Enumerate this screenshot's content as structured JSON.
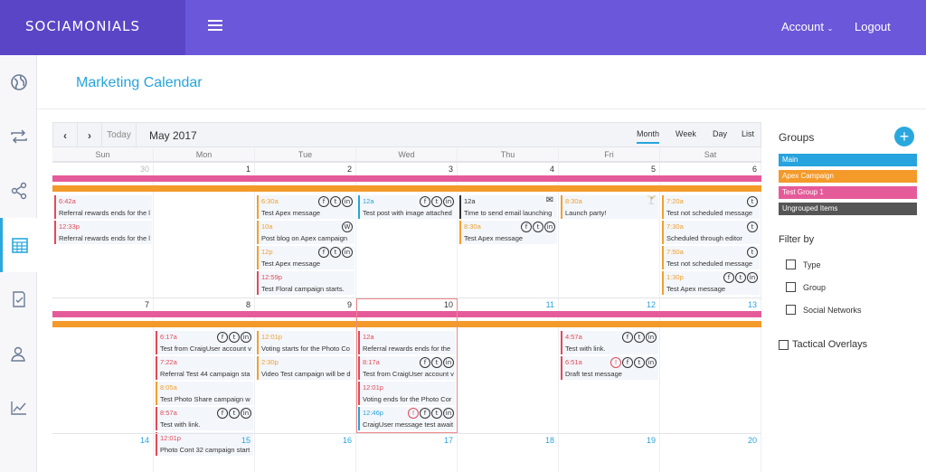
{
  "header": {
    "logo": "SOCIAMONIALS",
    "account_label": "Account",
    "logout_label": "Logout"
  },
  "sidebar": {
    "items": [
      {
        "icon": "globe-icon"
      },
      {
        "icon": "repeat-icon"
      },
      {
        "icon": "share-icon"
      },
      {
        "icon": "calendar-icon",
        "active": true
      },
      {
        "icon": "document-check-icon"
      },
      {
        "icon": "users-icon"
      },
      {
        "icon": "chart-icon"
      }
    ]
  },
  "page": {
    "title": "Marketing Calendar"
  },
  "calendar": {
    "today_label": "Today",
    "month_label": "May 2017",
    "views": [
      "Month",
      "Week",
      "Day",
      "List"
    ],
    "active_view": "Month",
    "dow": [
      "Sun",
      "Mon",
      "Tue",
      "Wed",
      "Thu",
      "Fri",
      "Sat"
    ],
    "weeks": [
      {
        "days": [
          "30",
          "1",
          "2",
          "3",
          "4",
          "5",
          "6"
        ],
        "events": [
          {
            "col": 0,
            "row": 0,
            "time": "6:42a",
            "text": "Referral rewards ends for the l",
            "color": "#e04b5a",
            "icons": []
          },
          {
            "col": 0,
            "row": 1,
            "time": "12:33p",
            "text": "Referral rewards ends for the l",
            "color": "#e04b5a",
            "icons": []
          },
          {
            "col": 2,
            "row": 0,
            "time": "6:30a",
            "text": "Test Apex message",
            "color": "#f0a030",
            "icons": [
              "f",
              "t",
              "in"
            ]
          },
          {
            "col": 2,
            "row": 1,
            "time": "10a",
            "text": "Post blog on Apex campaign",
            "color": "#f0a030",
            "icons": [
              "W"
            ]
          },
          {
            "col": 2,
            "row": 2,
            "time": "12p",
            "text": "Test Apex message",
            "color": "#f0a030",
            "icons": [
              "f",
              "t",
              "in"
            ]
          },
          {
            "col": 2,
            "row": 3,
            "time": "12:59p",
            "text": "Test Floral campaign starts.",
            "color": "#e04b5a",
            "icons": []
          },
          {
            "col": 3,
            "row": 0,
            "time": "12a",
            "text": "Test post with image attached",
            "color": "#27a4dd",
            "icons": [
              "f",
              "t",
              "in"
            ]
          },
          {
            "col": 4,
            "row": 0,
            "time": "12a",
            "text": "Time to send email launching",
            "color": "#333333",
            "icons": [
              "✉"
            ]
          },
          {
            "col": 4,
            "row": 1,
            "time": "8:30a",
            "text": "Test Apex message",
            "color": "#f0a030",
            "icons": [
              "f",
              "t",
              "in"
            ]
          },
          {
            "col": 5,
            "row": 0,
            "time": "8:30a",
            "text": "Launch party!",
            "color": "#f0a030",
            "icons": [
              "🍸"
            ]
          },
          {
            "col": 6,
            "row": 0,
            "time": "7:20a",
            "text": "Test not scheduled message",
            "color": "#f0a030",
            "icons": [
              "t"
            ]
          },
          {
            "col": 6,
            "row": 1,
            "time": "7:30a",
            "text": "Scheduled through editor",
            "color": "#f0a030",
            "icons": [
              "t"
            ]
          },
          {
            "col": 6,
            "row": 2,
            "time": "7:50a",
            "text": "Test not scheduled message",
            "color": "#f0a030",
            "icons": [
              "t"
            ]
          },
          {
            "col": 6,
            "row": 3,
            "time": "1:30p",
            "text": "Test Apex message",
            "color": "#f0a030",
            "icons": [
              "f",
              "t",
              "in"
            ]
          }
        ]
      },
      {
        "days": [
          "7",
          "8",
          "9",
          "10",
          "11",
          "12",
          "13"
        ],
        "events": [
          {
            "col": 1,
            "row": 0,
            "time": "6:17a",
            "text": "Test from CraigUser account v",
            "color": "#e04b5a",
            "icons": [
              "f",
              "t",
              "in"
            ]
          },
          {
            "col": 1,
            "row": 1,
            "time": "7:22a",
            "text": "Referral Test 44 campaign sta",
            "color": "#e04b5a",
            "icons": []
          },
          {
            "col": 1,
            "row": 2,
            "time": "8:05a",
            "text": "Test Photo Share campaign w",
            "color": "#f0a030",
            "icons": []
          },
          {
            "col": 1,
            "row": 3,
            "time": "8:57a",
            "text": "Test with link.",
            "color": "#e04b5a",
            "icons": [
              "f",
              "t",
              "in"
            ]
          },
          {
            "col": 1,
            "row": 4,
            "time": "12:01p",
            "text": "Photo Cont 32 campaign start",
            "color": "#e04b5a",
            "icons": []
          },
          {
            "col": 2,
            "row": 0,
            "time": "12:01p",
            "text": "Voting starts for the Photo Co",
            "color": "#f0a030",
            "icons": []
          },
          {
            "col": 2,
            "row": 1,
            "time": "2:30p",
            "text": "Video Test campaign will be d",
            "color": "#f0a030",
            "icons": []
          },
          {
            "col": 3,
            "row": 0,
            "time": "12a",
            "text": "Referral rewards ends for the",
            "color": "#e04b5a",
            "icons": []
          },
          {
            "col": 3,
            "row": 1,
            "time": "8:17a",
            "text": "Test from CraigUser account v",
            "color": "#e04b5a",
            "icons": [
              "f",
              "t",
              "in"
            ]
          },
          {
            "col": 3,
            "row": 2,
            "time": "12:01p",
            "text": "Voting ends for the Photo Cor",
            "color": "#e04b5a",
            "icons": []
          },
          {
            "col": 3,
            "row": 3,
            "time": "12:46p",
            "text": "CraigUser message test await",
            "color": "#27a4dd",
            "icons": [
              "!",
              "f",
              "t",
              "in"
            ]
          },
          {
            "col": 5,
            "row": 0,
            "time": "4:57a",
            "text": "Test with link.",
            "color": "#e04b5a",
            "icons": [
              "f",
              "t",
              "in"
            ]
          },
          {
            "col": 5,
            "row": 1,
            "time": "6:51a",
            "text": "Draft test message",
            "color": "#e04b5a",
            "icons": [
              "!",
              "f",
              "t",
              "in"
            ]
          }
        ]
      },
      {
        "days": [
          "14",
          "15",
          "16",
          "17",
          "18",
          "19",
          "20"
        ],
        "events": []
      }
    ]
  },
  "groups": {
    "title": "Groups",
    "items": [
      {
        "label": "Main",
        "color": "#27a4dd"
      },
      {
        "label": "Apex Campaign",
        "color": "#f39a2a"
      },
      {
        "label": "Test Group 1",
        "color": "#e55b9a"
      },
      {
        "label": "Ungrouped Items",
        "color": "#555555"
      }
    ]
  },
  "filters": {
    "title": "Filter by",
    "items": [
      "Type",
      "Group",
      "Social Networks"
    ],
    "tactical_label": "Tactical Overlays"
  },
  "colors": {
    "band_pink": "#e55b9a",
    "band_orange": "#f39a2a"
  }
}
